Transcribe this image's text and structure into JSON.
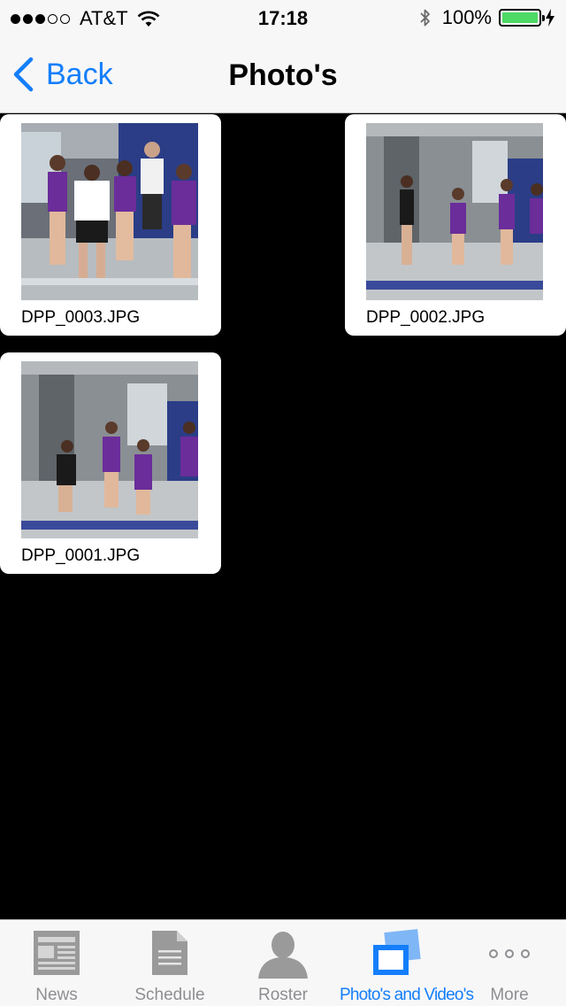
{
  "status_bar": {
    "carrier": "AT&T",
    "time": "17:18",
    "battery_percent": "100%",
    "signal_bars_filled": 3,
    "signal_bars_total": 5,
    "battery_level": 1.0,
    "battery_color": "#4cd964"
  },
  "nav": {
    "back_label": "Back",
    "title": "Photo's",
    "accent_color": "#147efb"
  },
  "photos": [
    {
      "filename": "DPP_0003.JPG"
    },
    {
      "filename": "DPP_0002.JPG"
    },
    {
      "filename": "DPP_0001.JPG"
    }
  ],
  "tabs": [
    {
      "label": "News",
      "icon": "newspaper-icon",
      "active": false
    },
    {
      "label": "Schedule",
      "icon": "document-icon",
      "active": false
    },
    {
      "label": "Roster",
      "icon": "person-icon",
      "active": false
    },
    {
      "label": "Photo's and Video's",
      "icon": "photos-icon",
      "active": true
    },
    {
      "label": "More",
      "icon": "more-dots-icon",
      "active": false
    }
  ]
}
